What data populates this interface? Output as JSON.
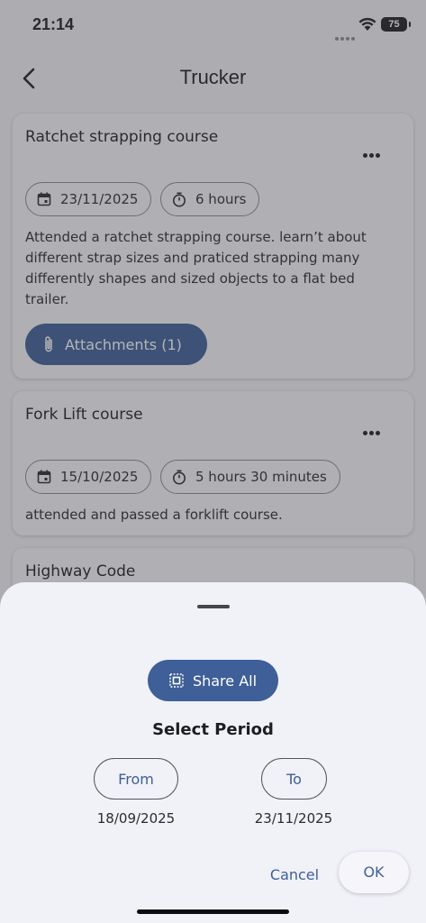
{
  "status_bar": {
    "time": "21:14",
    "battery": "75"
  },
  "header": {
    "title": "Trucker"
  },
  "entries": [
    {
      "title": "Ratchet strapping course",
      "date": "23/11/2025",
      "duration": "6 hours",
      "description": "Attended a ratchet strapping course. learn’t about different strap sizes and praticed strapping many differently shapes and sized objects to a flat bed trailer.",
      "attachments_label": "Attachments (1)"
    },
    {
      "title": "Fork Lift course",
      "date": "15/10/2025",
      "duration": "5 hours 30 minutes",
      "description": "attended and passed a forklift course."
    },
    {
      "title": "Highway Code"
    }
  ],
  "sheet": {
    "share_all_label": "Share All",
    "select_period_label": "Select Period",
    "from_label": "From",
    "to_label": "To",
    "from_date": "18/09/2025",
    "to_date": "23/11/2025",
    "cancel_label": "Cancel",
    "ok_label": "OK"
  },
  "colors": {
    "accent": "#3e5f97",
    "background": "#f1f1f6"
  }
}
